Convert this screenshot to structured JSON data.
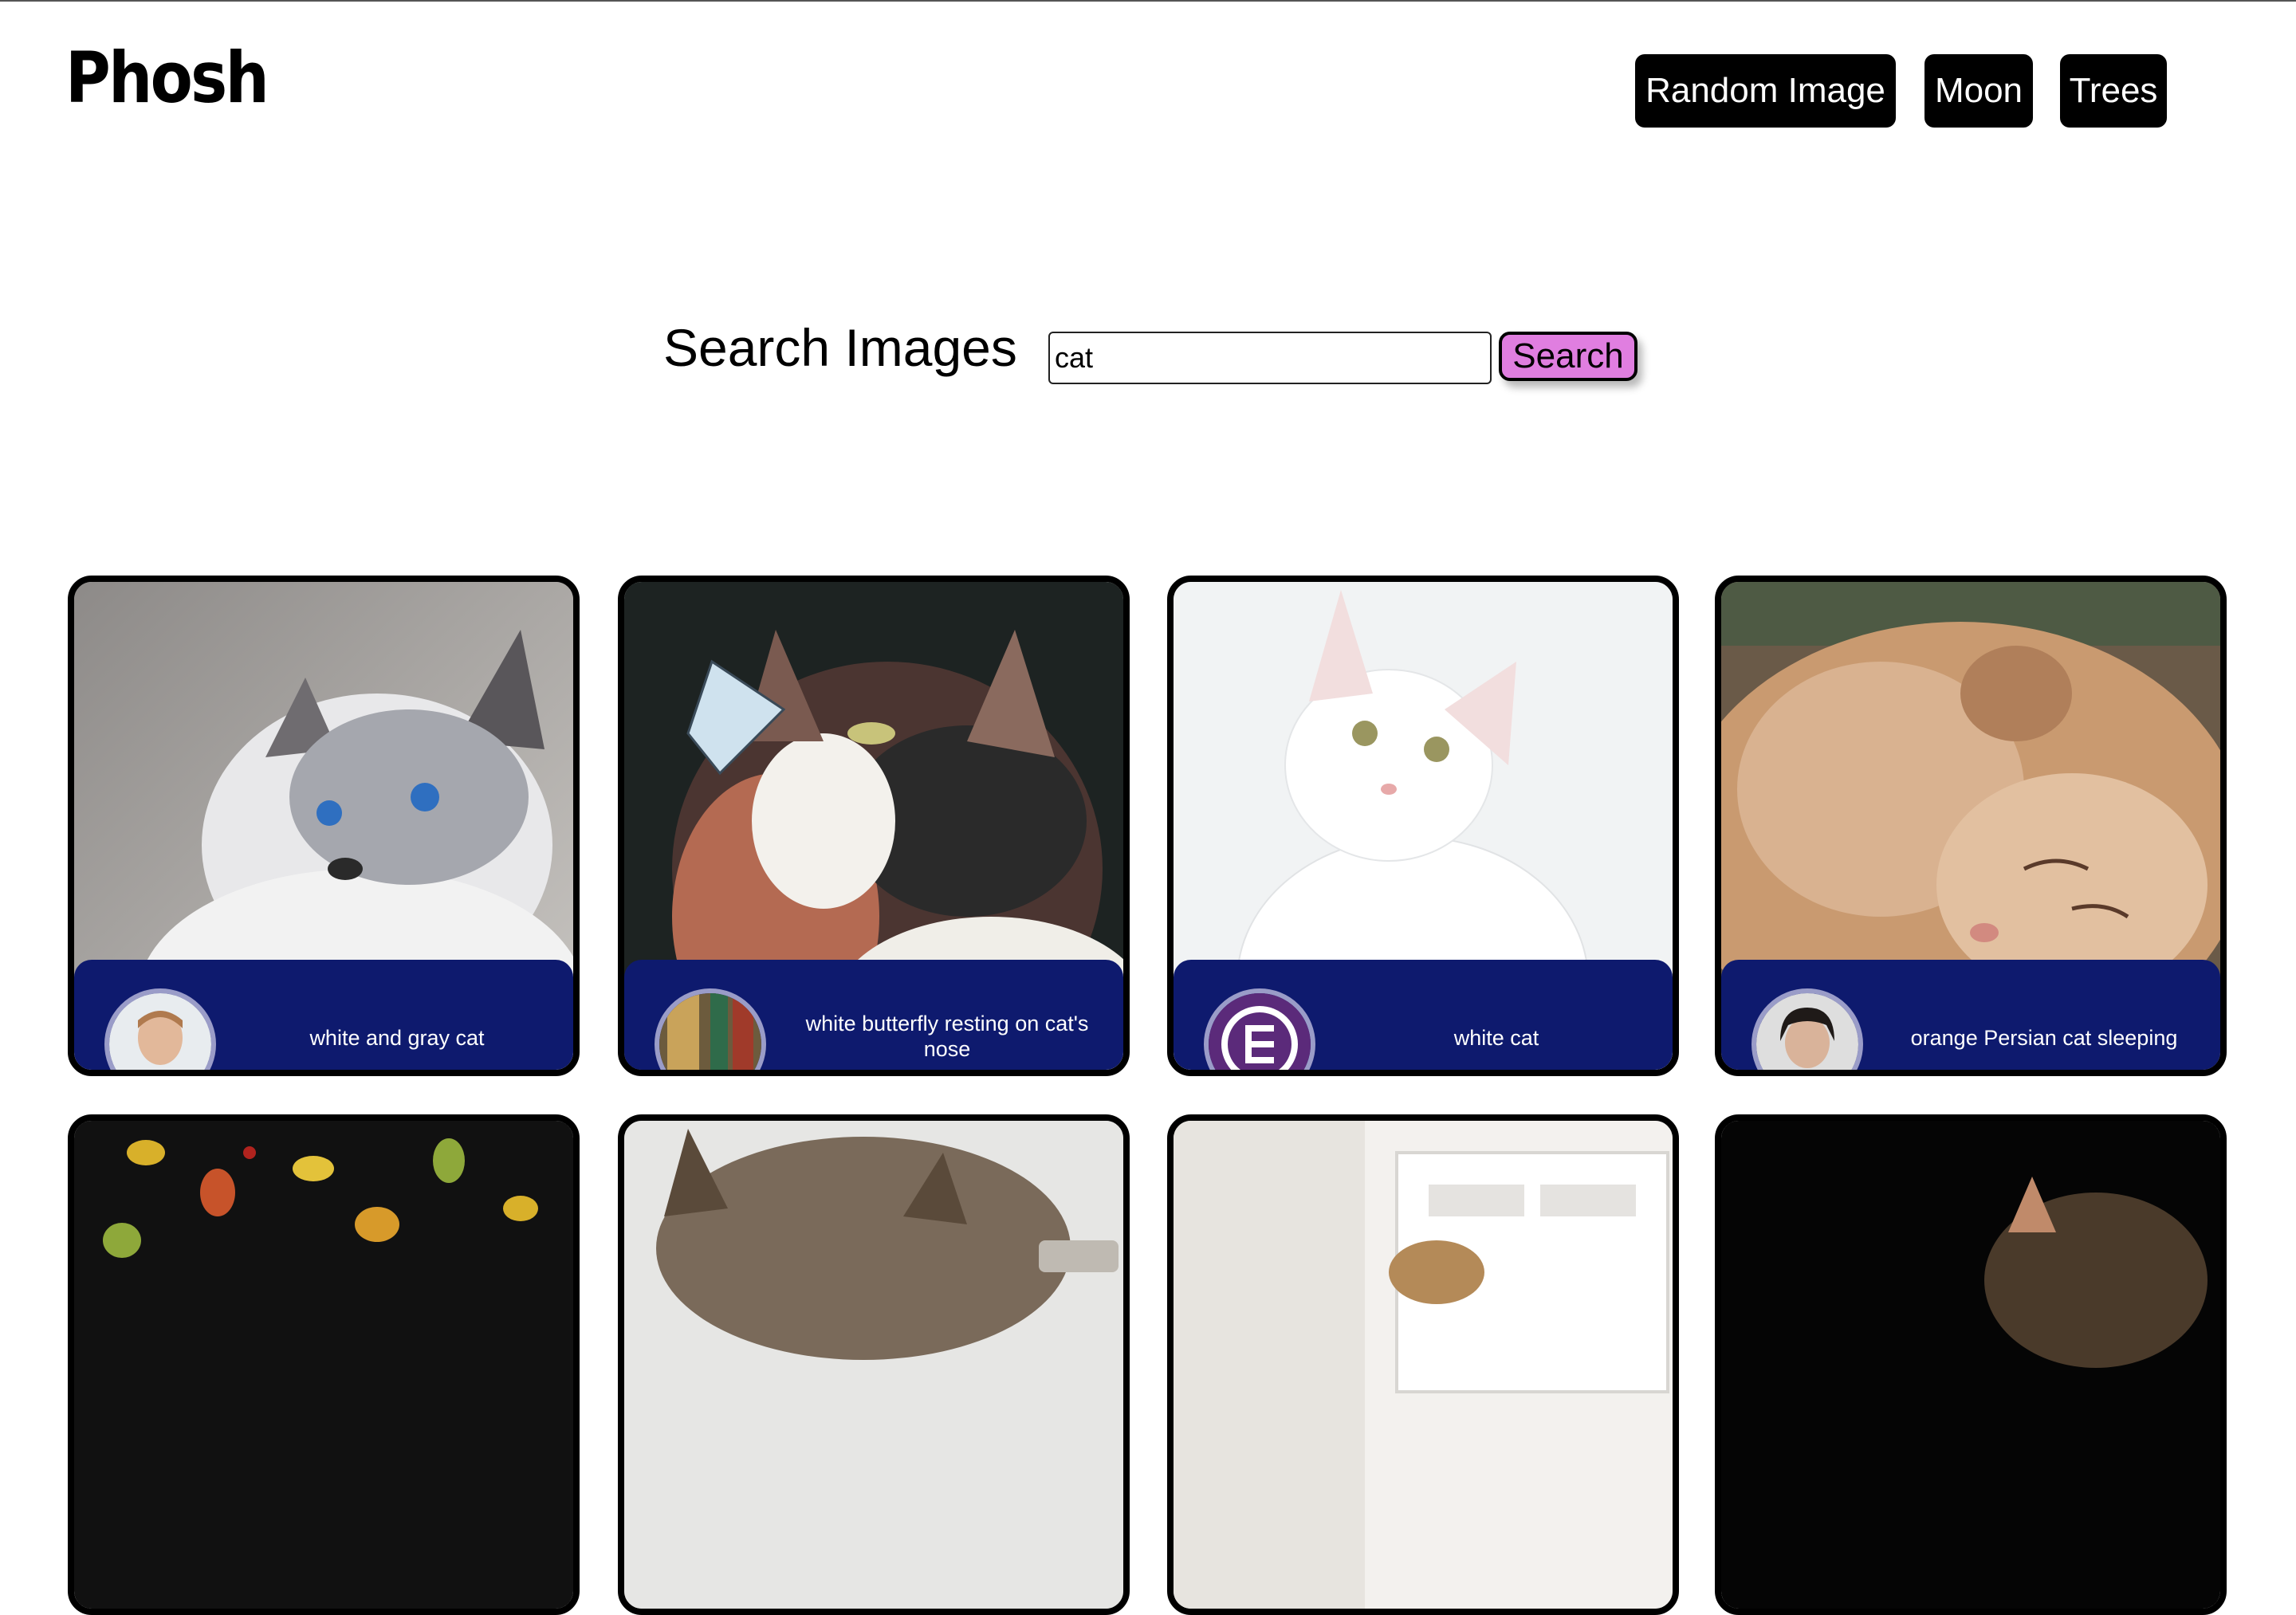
{
  "header": {
    "logo": "Phosh",
    "nav": [
      {
        "label": "Random Image"
      },
      {
        "label": "Moon"
      },
      {
        "label": "Trees"
      }
    ]
  },
  "search": {
    "title": "Search Images",
    "value": "cat",
    "button_label": "Search"
  },
  "results": [
    {
      "caption": "white and gray cat"
    },
    {
      "caption": "white butterfly resting on cat's nose"
    },
    {
      "caption": "white cat"
    },
    {
      "caption": "orange Persian cat sleeping"
    }
  ],
  "colors": {
    "accent_button": "#e07ee0",
    "card_footer": "#0e1a6e",
    "nav_button": "#000000"
  }
}
